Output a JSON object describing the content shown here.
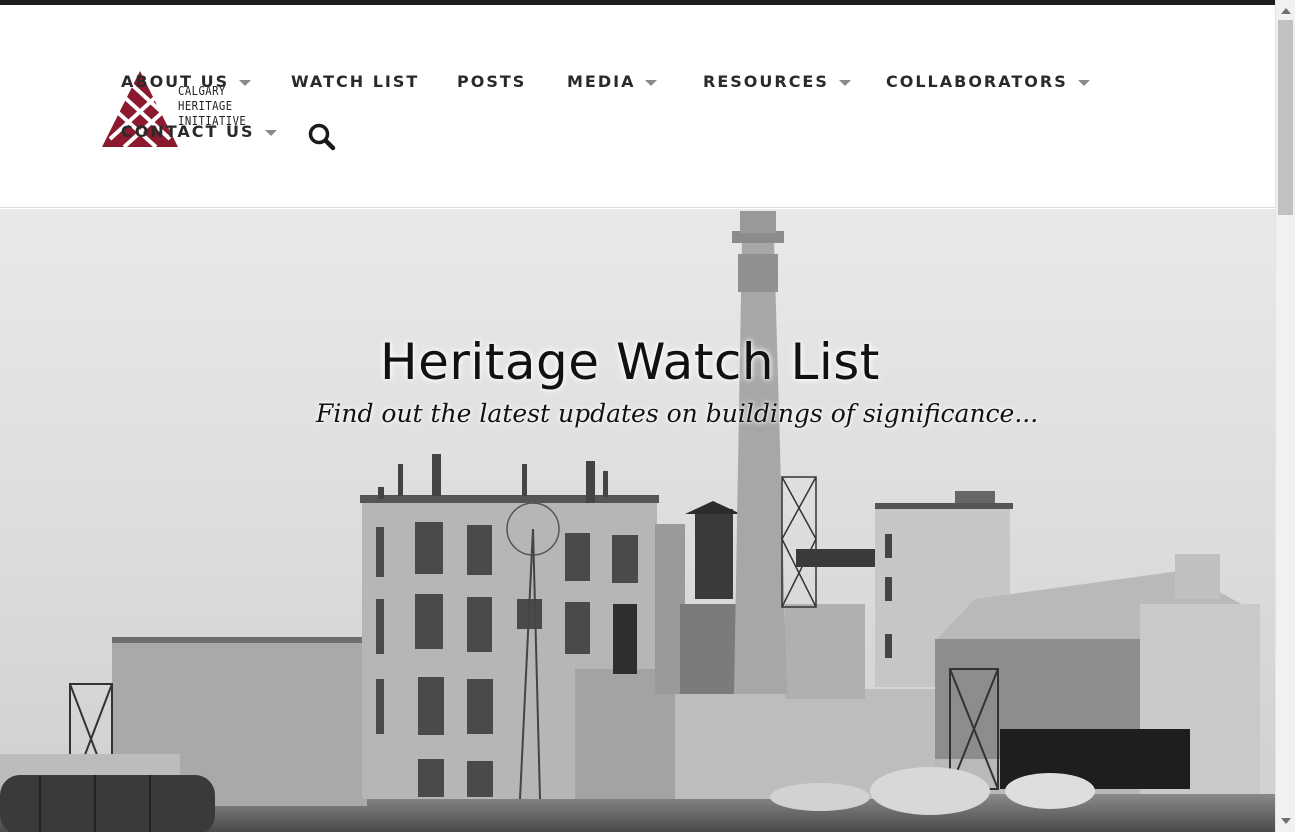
{
  "site": {
    "logo_lines": [
      "CALGARY",
      "HERITAGE",
      "INITIATIVE"
    ],
    "brand_color": "#8b1a2e"
  },
  "nav": {
    "items": [
      {
        "label": "ABOUT US",
        "has_dropdown": true
      },
      {
        "label": "WATCH LIST",
        "has_dropdown": false
      },
      {
        "label": "POSTS",
        "has_dropdown": false
      },
      {
        "label": "MEDIA",
        "has_dropdown": true
      },
      {
        "label": "RESOURCES",
        "has_dropdown": true
      },
      {
        "label": "COLLABORATORS",
        "has_dropdown": true
      },
      {
        "label": "CONTACT US",
        "has_dropdown": true
      }
    ],
    "search_icon": "search-icon"
  },
  "hero": {
    "title": "Heritage Watch List",
    "subtitle": "Find out the latest updates on buildings of significance..."
  }
}
